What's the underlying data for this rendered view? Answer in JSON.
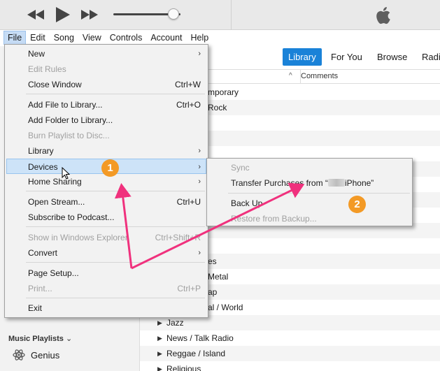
{
  "player": {
    "icons": [
      "rewind-icon",
      "play-icon",
      "fast-forward-icon",
      "apple-logo"
    ],
    "volume_level": 0.9
  },
  "menubar": {
    "items": [
      "File",
      "Edit",
      "Song",
      "View",
      "Controls",
      "Account",
      "Help"
    ],
    "active": "File"
  },
  "nav": {
    "tabs": [
      "Library",
      "For You",
      "Browse",
      "Radi"
    ],
    "active": "Library"
  },
  "list": {
    "header_comments": "Comments",
    "visible_rows": [
      "mporary",
      "Rock",
      "",
      "",
      "",
      "",
      "",
      "",
      "",
      "",
      "",
      "es",
      "Metal",
      "ap",
      "al / World",
      "Jazz",
      "News / Talk Radio",
      "Reggae / Island",
      "Religious"
    ]
  },
  "sidebar": {
    "section_header": "Music Playlists",
    "section_caret": "⌄",
    "genius_label": "Genius"
  },
  "file_menu": {
    "items": [
      {
        "label": "New",
        "submenu": true
      },
      {
        "label": "Edit Rules",
        "disabled": true
      },
      {
        "label": "Close Window",
        "shortcut": "Ctrl+W"
      },
      {
        "label": "Add File to Library...",
        "shortcut": "Ctrl+O"
      },
      {
        "label": "Add Folder to Library..."
      },
      {
        "label": "Burn Playlist to Disc...",
        "disabled": true
      },
      {
        "label": "Library",
        "submenu": true
      },
      {
        "label": "Devices",
        "submenu": true,
        "highlighted": true
      },
      {
        "label": "Home Sharing",
        "submenu": true
      },
      {
        "label": "Open Stream...",
        "shortcut": "Ctrl+U"
      },
      {
        "label": "Subscribe to Podcast..."
      },
      {
        "label": "Show in Windows Explorer",
        "shortcut": "Ctrl+Shift+R",
        "disabled": true
      },
      {
        "label": "Convert",
        "submenu": true
      },
      {
        "label": "Page Setup..."
      },
      {
        "label": "Print...",
        "shortcut": "Ctrl+P",
        "disabled": true
      },
      {
        "label": "Exit"
      }
    ],
    "submenu_arrow": "›"
  },
  "devices_submenu": {
    "items": [
      {
        "label": "Sync",
        "disabled": true
      },
      {
        "label_prefix": "Transfer Purchases from “",
        "label_suffix": "iPhone”"
      },
      {
        "label": "Back Up"
      },
      {
        "label": "Restore from Backup...",
        "disabled": true
      }
    ]
  },
  "annotations": {
    "badge_1": "1",
    "badge_2": "2",
    "arrow_color": "#f0317d",
    "badge_color": "#f39a26"
  },
  "colors": {
    "accent": "#1a82d8",
    "menu_highlight": "#cde3f8"
  }
}
